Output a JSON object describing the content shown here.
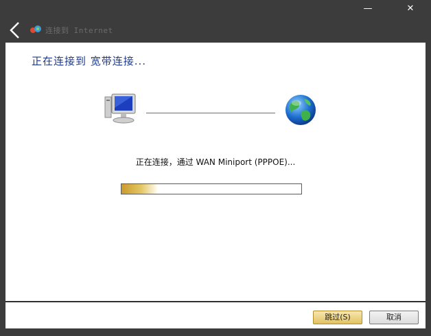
{
  "window": {
    "minimize_label": "—",
    "close_label": "✕"
  },
  "nav": {
    "title": "连接到 Internet"
  },
  "main": {
    "heading": "正在连接到 宽带连接...",
    "status": "正在连接，通过 WAN Miniport (PPPOE)...",
    "progress": 0.2
  },
  "footer": {
    "skip_label": "跳过(S)",
    "cancel_label": "取消"
  },
  "icons": {
    "back": "back-arrow-icon",
    "app": "network-icon",
    "computer": "computer-icon",
    "globe": "globe-icon"
  }
}
